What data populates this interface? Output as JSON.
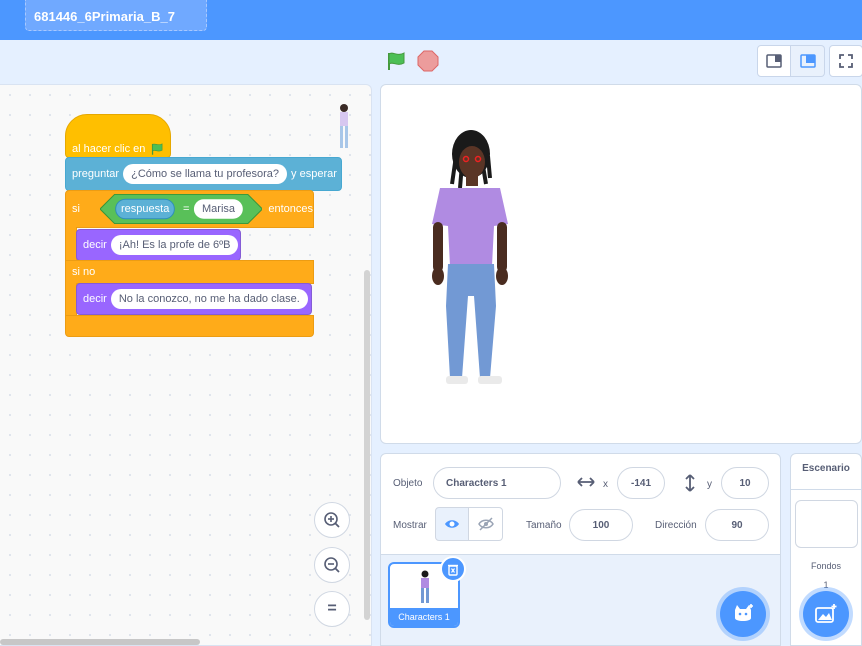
{
  "project": {
    "title": "681446_6Primaria_B_7"
  },
  "colors": {
    "brand": "#4c97ff",
    "events": "#ffbf00",
    "control": "#ffab19",
    "sensing": "#5cb1d6",
    "looks": "#9966ff",
    "operators": "#59c059"
  },
  "script": {
    "hat": {
      "label": "al hacer clic en",
      "icon": "green-flag-icon"
    },
    "ask": {
      "label": "preguntar",
      "value": "¿Cómo  se llama tu profesora?",
      "suffix": "y esperar"
    },
    "if_else": {
      "if_label": "si",
      "then_label": "entonces",
      "else_label": "si no"
    },
    "condition": {
      "reporter": "respuesta",
      "operator": "=",
      "value": "Marisa"
    },
    "say_then": {
      "label": "decir",
      "value": "¡Ah! Es la profe de 6ºB"
    },
    "say_else": {
      "label": "decir",
      "value": "No la conozco, no me ha dado clase."
    }
  },
  "zoom": {
    "in_icon": "zoom-in-icon",
    "out_icon": "zoom-out-icon",
    "reset_label": "="
  },
  "sprite_info": {
    "sprite_label": "Objeto",
    "sprite_name": "Characters 1",
    "x_label": "x",
    "x_value": "-141",
    "y_label": "y",
    "y_value": "10",
    "show_label": "Mostrar",
    "size_label": "Tamaño",
    "size_value": "100",
    "direction_label": "Dirección",
    "direction_value": "90"
  },
  "sprite_list": {
    "items": [
      {
        "name": "Characters 1"
      }
    ]
  },
  "backdrops": {
    "title": "Escenario",
    "label": "Fondos",
    "count": "1"
  }
}
